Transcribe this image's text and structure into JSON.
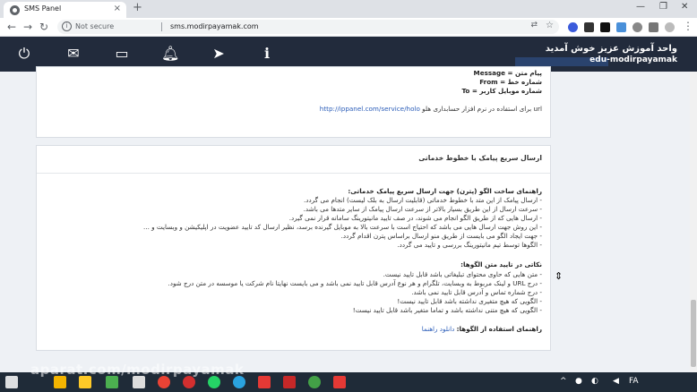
{
  "browser": {
    "tab_title": "SMS Panel",
    "tab_close": "×",
    "new_tab": "+",
    "win_min": "—",
    "win_max": "❐",
    "win_close": "✕",
    "not_secure": "Not secure",
    "url": "sms.modirpayamak.com"
  },
  "header": {
    "welcome": "واحد آموزش عزیز خوش آمدید",
    "username": "edu-modirpayamak"
  },
  "card1": {
    "lines": [
      "پیام متن = Message",
      "شماره خط = From",
      "شماره موبایل کاربر = To"
    ],
    "url_note": "برای استفاده در نرم افزار حسابداری هلو",
    "url_prefix": "url",
    "url_link": "http://ippanel.com/service/holo"
  },
  "card2": {
    "title": "ارسال سریع پیامک با خطوط خدماتی",
    "guide_heading": "راهنمای ساخت الگو (پترن) جهت ارسال سریع پیامک خدماتی:",
    "guide_items": [
      "- ارسال پیامک از این متد با خطوط خدماتی (قابلیت ارسال به بلک لیست) انجام می گردد.",
      "- سرعت ارسال از این طریق بسیار بالاتر از سرعت ارسال پیامک از سایر متدها می باشد.",
      "- ارسال هایی که از طریق الگو انجام می شوند، در صف تایید مانیتورینگ سامانه قرار نمی گیرد.",
      "- این روش جهت ارسال هایی می باشد که احتیاج است با سرعت بالا به موبایل گیرنده برسد، نظیر ارسال کد تایید عضویت در اپلیکیشن و وبسایت و ...",
      "- جهت ایجاد الگو می بایست از طریق منو ارسال براساس پترن اقدام گردد.",
      "- الگوها توسط تیم مانیتورینگ بررسی و تایید می گردد."
    ],
    "tips_heading": "نکاتی در تایید متن الگوها:",
    "tips_items": [
      "- متن هایی که حاوی محتوای تبلیغاتی باشد قابل تایید نیست.",
      "- درج URL و لینک مربوط به وبسایت، تلگرام و هر نوع آدرس قابل تایید نمی باشد و می بایست نهایتا نام شرکت یا موسسه در متن درج شود.",
      "- درج شماره تماس و آدرس قابل تایید نمی باشد.",
      "- الگویی که هیچ متغیری نداشته باشد قابل تایید نیست!",
      "- الگویی که هیچ متنی نداشته باشد و تماما متغیر باشد قابل تایید نیست!"
    ],
    "usage_label": "راهنمای استفاده از الگوها:",
    "usage_link": "دانلود راهنما"
  },
  "taskbar": {
    "watermark": "aparat.com/modirpayamak",
    "lang": "FA"
  },
  "colors": {
    "header_bg": "#222b3c",
    "page_bg": "#eef1f5",
    "link": "#2a5cb8"
  },
  "icons": [
    "power-icon",
    "envelope-icon",
    "card-icon",
    "bell-icon",
    "send-icon",
    "info-icon"
  ]
}
